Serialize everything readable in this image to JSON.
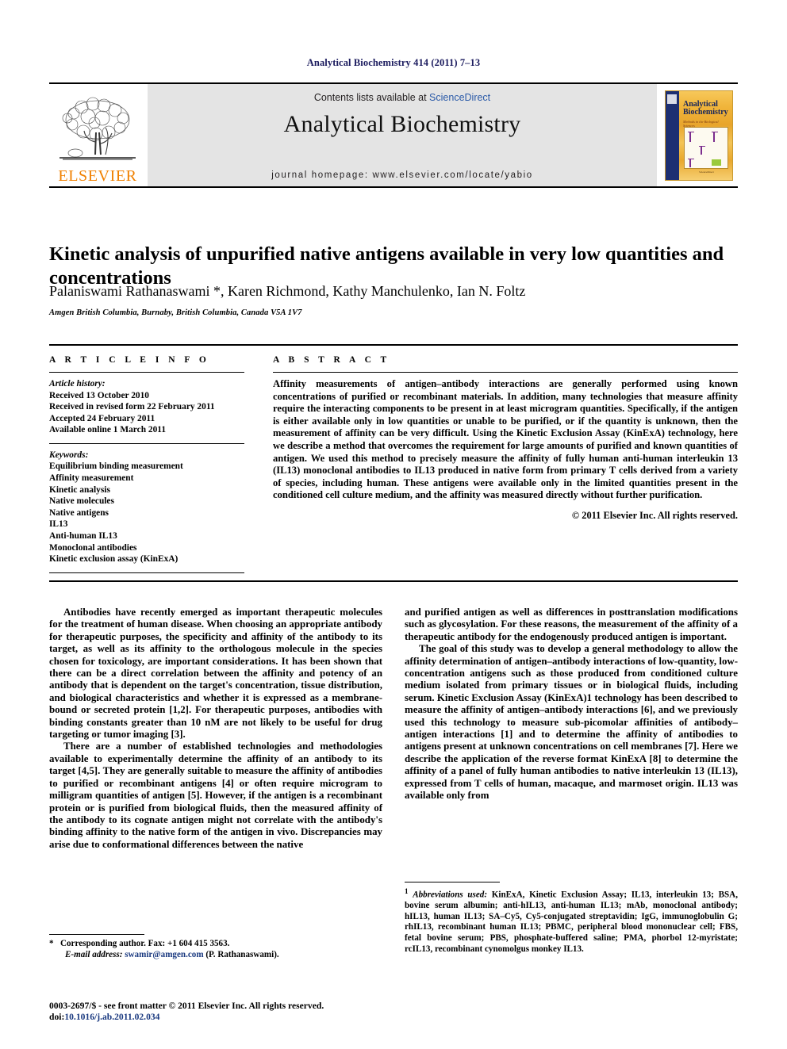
{
  "running_head": "Analytical Biochemistry 414 (2011) 7–13",
  "masthead": {
    "publisher_wordmark": "ELSEVIER",
    "contents_prefix": "Contents lists available at ",
    "contents_link": "ScienceDirect",
    "journal_name": "Analytical Biochemistry",
    "homepage": "journal homepage: www.elsevier.com/locate/yabio",
    "cover": {
      "title": "Analytical Biochemistry",
      "subtitle": "Methods in the Biological Sciences",
      "footer": "ScienceDirect"
    }
  },
  "article": {
    "title": "Kinetic analysis of unpurified native antigens available in very low quantities and concentrations",
    "authors": "Palaniswami Rathanaswami *, Karen Richmond, Kathy Manchulenko, Ian N. Foltz",
    "affiliation": "Amgen British Columbia, Burnaby, British Columbia, Canada V5A 1V7"
  },
  "article_info": {
    "heading": "A R T I C L E   I N F O",
    "history_label": "Article history:",
    "history": [
      "Received 13 October 2010",
      "Received in revised form 22 February 2011",
      "Accepted 24 February 2011",
      "Available online 1 March 2011"
    ],
    "keywords_label": "Keywords:",
    "keywords": [
      "Equilibrium binding measurement",
      "Affinity measurement",
      "Kinetic analysis",
      "Native molecules",
      "Native antigens",
      "IL13",
      "Anti-human IL13",
      "Monoclonal antibodies",
      "Kinetic exclusion assay (KinExA)"
    ]
  },
  "abstract": {
    "heading": "A B S T R A C T",
    "text": "Affinity measurements of antigen–antibody interactions are generally performed using known concentrations of purified or recombinant materials. In addition, many technologies that measure affinity require the interacting components to be present in at least microgram quantities. Specifically, if the antigen is either available only in low quantities or unable to be purified, or if the quantity is unknown, then the measurement of affinity can be very difficult. Using the Kinetic Exclusion Assay (KinExA) technology, here we describe a method that overcomes the requirement for large amounts of purified and known quantities of antigen. We used this method to precisely measure the affinity of fully human anti-human interleukin 13 (IL13) monoclonal antibodies to IL13 produced in native form from primary T cells derived from a variety of species, including human. These antigens were available only in the limited quantities present in the conditioned cell culture medium, and the affinity was measured directly without further purification.",
    "copyright": "© 2011 Elsevier Inc. All rights reserved."
  },
  "body": {
    "left": [
      "Antibodies have recently emerged as important therapeutic molecules for the treatment of human disease. When choosing an appropriate antibody for therapeutic purposes, the specificity and affinity of the antibody to its target, as well as its affinity to the orthologous molecule in the species chosen for toxicology, are important considerations. It has been shown that there can be a direct correlation between the affinity and potency of an antibody that is dependent on the target's concentration, tissue distribution, and biological characteristics and whether it is expressed as a membrane-bound or secreted protein [1,2]. For therapeutic purposes, antibodies with binding constants greater than 10 nM are not likely to be useful for drug targeting or tumor imaging [3].",
      "There are a number of established technologies and methodologies available to experimentally determine the affinity of an antibody to its target [4,5]. They are generally suitable to measure the affinity of antibodies to purified or recombinant antigens [4] or often require microgram to milligram quantities of antigen [5]. However, if the antigen is a recombinant protein or is purified from biological fluids, then the measured affinity of the antibody to its cognate antigen might not correlate with the antibody's binding affinity to the native form of the antigen in vivo. Discrepancies may arise due to conformational differences between the native"
    ],
    "right": [
      "and purified antigen as well as differences in posttranslation modifications such as glycosylation. For these reasons, the measurement of the affinity of a therapeutic antibody for the endogenously produced antigen is important.",
      "The goal of this study was to develop a general methodology to allow the affinity determination of antigen–antibody interactions of low-quantity, low-concentration antigens such as those produced from conditioned culture medium isolated from primary tissues or in biological fluids, including serum. Kinetic Exclusion Assay (KinExA)1 technology has been described to measure the affinity of antigen–antibody interactions [6], and we previously used this technology to measure sub-picomolar affinities of antibody–antigen interactions [1] and to determine the affinity of antibodies to antigens present at unknown concentrations on cell membranes [7]. Here we describe the application of the reverse format KinExA [8] to determine the affinity of a panel of fully human antibodies to native interleukin 13 (IL13), expressed from T cells of human, macaque, and marmoset origin. IL13 was available only from"
    ]
  },
  "footnotes": {
    "corresponding_marker": "*",
    "corresponding": "Corresponding author. Fax: +1 604 415 3563.",
    "email_label": "E-mail address:",
    "email": "swamir@amgen.com",
    "email_suffix": "(P. Rathanaswami).",
    "abbrev_marker": "1",
    "abbrev_label": "Abbreviations used:",
    "abbrev_text": "KinExA, Kinetic Exclusion Assay; IL13, interleukin 13; BSA, bovine serum albumin; anti-hIL13, anti-human IL13; mAb, monoclonal antibody; hIL13, human IL13; SA–Cy5, Cy5-conjugated streptavidin; IgG, immunoglobulin G; rhIL13, recombinant human IL13; PBMC, peripheral blood mononuclear cell; FBS, fetal bovine serum; PBS, phosphate-buffered saline; PMA, phorbol 12-myristate; rcIL13, recombinant cynomolgus monkey IL13."
  },
  "imprint": {
    "issn_line": "0003-2697/$ - see front matter © 2011 Elsevier Inc. All rights reserved.",
    "doi_prefix": "doi:",
    "doi": "10.1016/j.ab.2011.02.034"
  },
  "colors": {
    "elsevier_orange": "#F08000",
    "link_blue": "#2b5aa8",
    "ref_blue": "#1b3a80",
    "running_head_navy": "#1b1b5e"
  }
}
